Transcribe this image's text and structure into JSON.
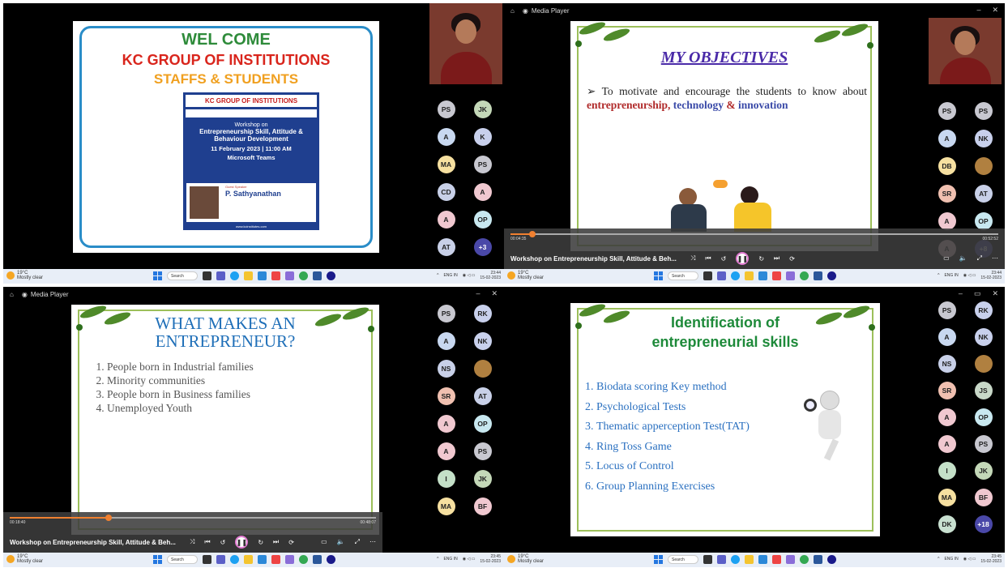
{
  "q1": {
    "slide": {
      "wel": "WEL COME",
      "org": "KC GROUP OF INSTITUTIONS",
      "staffs": "STAFFS & STUDENTS",
      "poster": {
        "org": "KC GROUP OF INSTITUTIONS",
        "ws": "Workshop on",
        "topic": "Entrepreneurship Skill, Attitude & Behaviour Development",
        "date": "11 February 2023",
        "time": "11:00 AM",
        "platform": "Microsoft Teams",
        "gs": "Guest Speaker",
        "speaker": "P. Sathyanathan",
        "site": "www.kcinstitutes.com"
      }
    },
    "participants": [
      {
        "i": "PS",
        "c": "#c8c8d0"
      },
      {
        "i": "JK",
        "c": "#c4d8b8"
      },
      {
        "i": "A",
        "c": "#c8d8f0"
      },
      {
        "i": "K",
        "c": "#c8d0ec"
      },
      {
        "i": "MA",
        "c": "#f6e0a0"
      },
      {
        "i": "PS",
        "c": "#c8c8d0"
      },
      {
        "i": "CD",
        "c": "#c8d0e8"
      },
      {
        "i": "A",
        "c": "#f0c8d0"
      },
      {
        "i": "A",
        "c": "#f0c8d0"
      },
      {
        "i": "OP",
        "c": "#c8e8f0"
      },
      {
        "i": "AT",
        "c": "#c8d0e8"
      },
      {
        "i": "+3",
        "c": "#4a48a8"
      }
    ],
    "taskbar": {
      "temp": "19°C",
      "cond": "Mostly clear",
      "search": "Search",
      "lang": "ENG",
      "region": "IN",
      "time": "23:44",
      "date": "15-02-2023"
    }
  },
  "q2": {
    "player": "Media Player",
    "slide": {
      "title": "MY OBJECTIVES",
      "bullet_a": "To motivate and encourage the students to know about",
      "w1": "entrepreneurship,",
      "w2": "technology",
      "w3": "&",
      "w4": "innovation"
    },
    "participants": [
      {
        "i": "PS",
        "c": "#c8c8d0"
      },
      {
        "i": "PS",
        "c": "#c8c8d0"
      },
      {
        "i": "A",
        "c": "#c8d8f0"
      },
      {
        "i": "NK",
        "c": "#c8d0ec"
      },
      {
        "i": "DB",
        "c": "#f6e0a0"
      },
      {
        "i": "",
        "c": "#b08040"
      },
      {
        "i": "SR",
        "c": "#f0c0b0"
      },
      {
        "i": "AT",
        "c": "#c8d0e8"
      },
      {
        "i": "A",
        "c": "#f0c8d0"
      },
      {
        "i": "OP",
        "c": "#c8e8f0"
      },
      {
        "i": "A",
        "c": "#f0c8d0"
      },
      {
        "i": "+8",
        "c": "#4a48a8"
      }
    ],
    "video": {
      "elapsed": "00:04:35",
      "total": "00:52:52",
      "progress": 0.045,
      "title": "Workshop on Entrepreneurship Skill, Attitude & Beh..."
    },
    "taskbar": {
      "temp": "19°C",
      "cond": "Mostly clear",
      "search": "Search",
      "lang": "ENG",
      "region": "IN",
      "time": "23:44",
      "date": "15-02-2023"
    }
  },
  "q3": {
    "player": "Media Player",
    "slide": {
      "title1": "WHAT MAKES AN",
      "title2": "ENTREPRENEUR?",
      "items": [
        "People born in Industrial families",
        "Minority communities",
        "People born in Business families",
        "Unemployed Youth"
      ]
    },
    "participants": [
      {
        "i": "PS",
        "c": "#c8c8d0"
      },
      {
        "i": "RK",
        "c": "#c8d0ec"
      },
      {
        "i": "A",
        "c": "#c8d8f0"
      },
      {
        "i": "NK",
        "c": "#c8d0ec"
      },
      {
        "i": "NS",
        "c": "#c8d0e8"
      },
      {
        "i": "",
        "c": "#b08040"
      },
      {
        "i": "SR",
        "c": "#f0c0b0"
      },
      {
        "i": "AT",
        "c": "#c8d0e8"
      },
      {
        "i": "A",
        "c": "#f0c8d0"
      },
      {
        "i": "OP",
        "c": "#c8e8f0"
      },
      {
        "i": "A",
        "c": "#f0c8d0"
      },
      {
        "i": "PS",
        "c": "#c8c8d0"
      },
      {
        "i": "I",
        "c": "#c4e0c8"
      },
      {
        "i": "JK",
        "c": "#c4d8b8"
      },
      {
        "i": "MA",
        "c": "#f6e0a0"
      },
      {
        "i": "BF",
        "c": "#f0c8d0"
      }
    ],
    "video": {
      "elapsed": "00:18:40",
      "total": "00:48:07",
      "progress": 0.27,
      "title": "Workshop on Entrepreneurship Skill, Attitude & Beh..."
    },
    "taskbar": {
      "temp": "19°C",
      "cond": "Mostly clear",
      "search": "Search",
      "lang": "ENG",
      "region": "IN",
      "time": "23:45",
      "date": "15-02-2023"
    }
  },
  "q4": {
    "slide": {
      "title1": "Identification of",
      "title2": "entrepreneurial skills",
      "items": [
        "Biodata scoring  Key method",
        "Psychological Tests",
        "Thematic apperception Test(TAT)",
        "Ring Toss Game",
        "Locus of Control",
        "Group Planning Exercises"
      ]
    },
    "participants": [
      {
        "i": "PS",
        "c": "#c8c8d0"
      },
      {
        "i": "RK",
        "c": "#c8d0ec"
      },
      {
        "i": "A",
        "c": "#c8d8f0"
      },
      {
        "i": "NK",
        "c": "#c8d0ec"
      },
      {
        "i": "NS",
        "c": "#c8d0e8"
      },
      {
        "i": "",
        "c": "#b08040"
      },
      {
        "i": "SR",
        "c": "#f0c0b0"
      },
      {
        "i": "JS",
        "c": "#c8d8c8"
      },
      {
        "i": "A",
        "c": "#f0c8d0"
      },
      {
        "i": "OP",
        "c": "#c8e8f0"
      },
      {
        "i": "A",
        "c": "#f0c8d0"
      },
      {
        "i": "PS",
        "c": "#c8c8d0"
      },
      {
        "i": "I",
        "c": "#c4e0c8"
      },
      {
        "i": "JK",
        "c": "#c4d8b8"
      },
      {
        "i": "MA",
        "c": "#f6e0a0"
      },
      {
        "i": "BF",
        "c": "#f0c8d0"
      },
      {
        "i": "DK",
        "c": "#c8e0d0"
      },
      {
        "i": "+18",
        "c": "#4a48a8"
      }
    ],
    "taskbar": {
      "temp": "19°C",
      "cond": "Mostly clear",
      "search": "Search",
      "lang": "ENG",
      "region": "IN",
      "time": "23:45",
      "date": "15-02-2023"
    }
  }
}
